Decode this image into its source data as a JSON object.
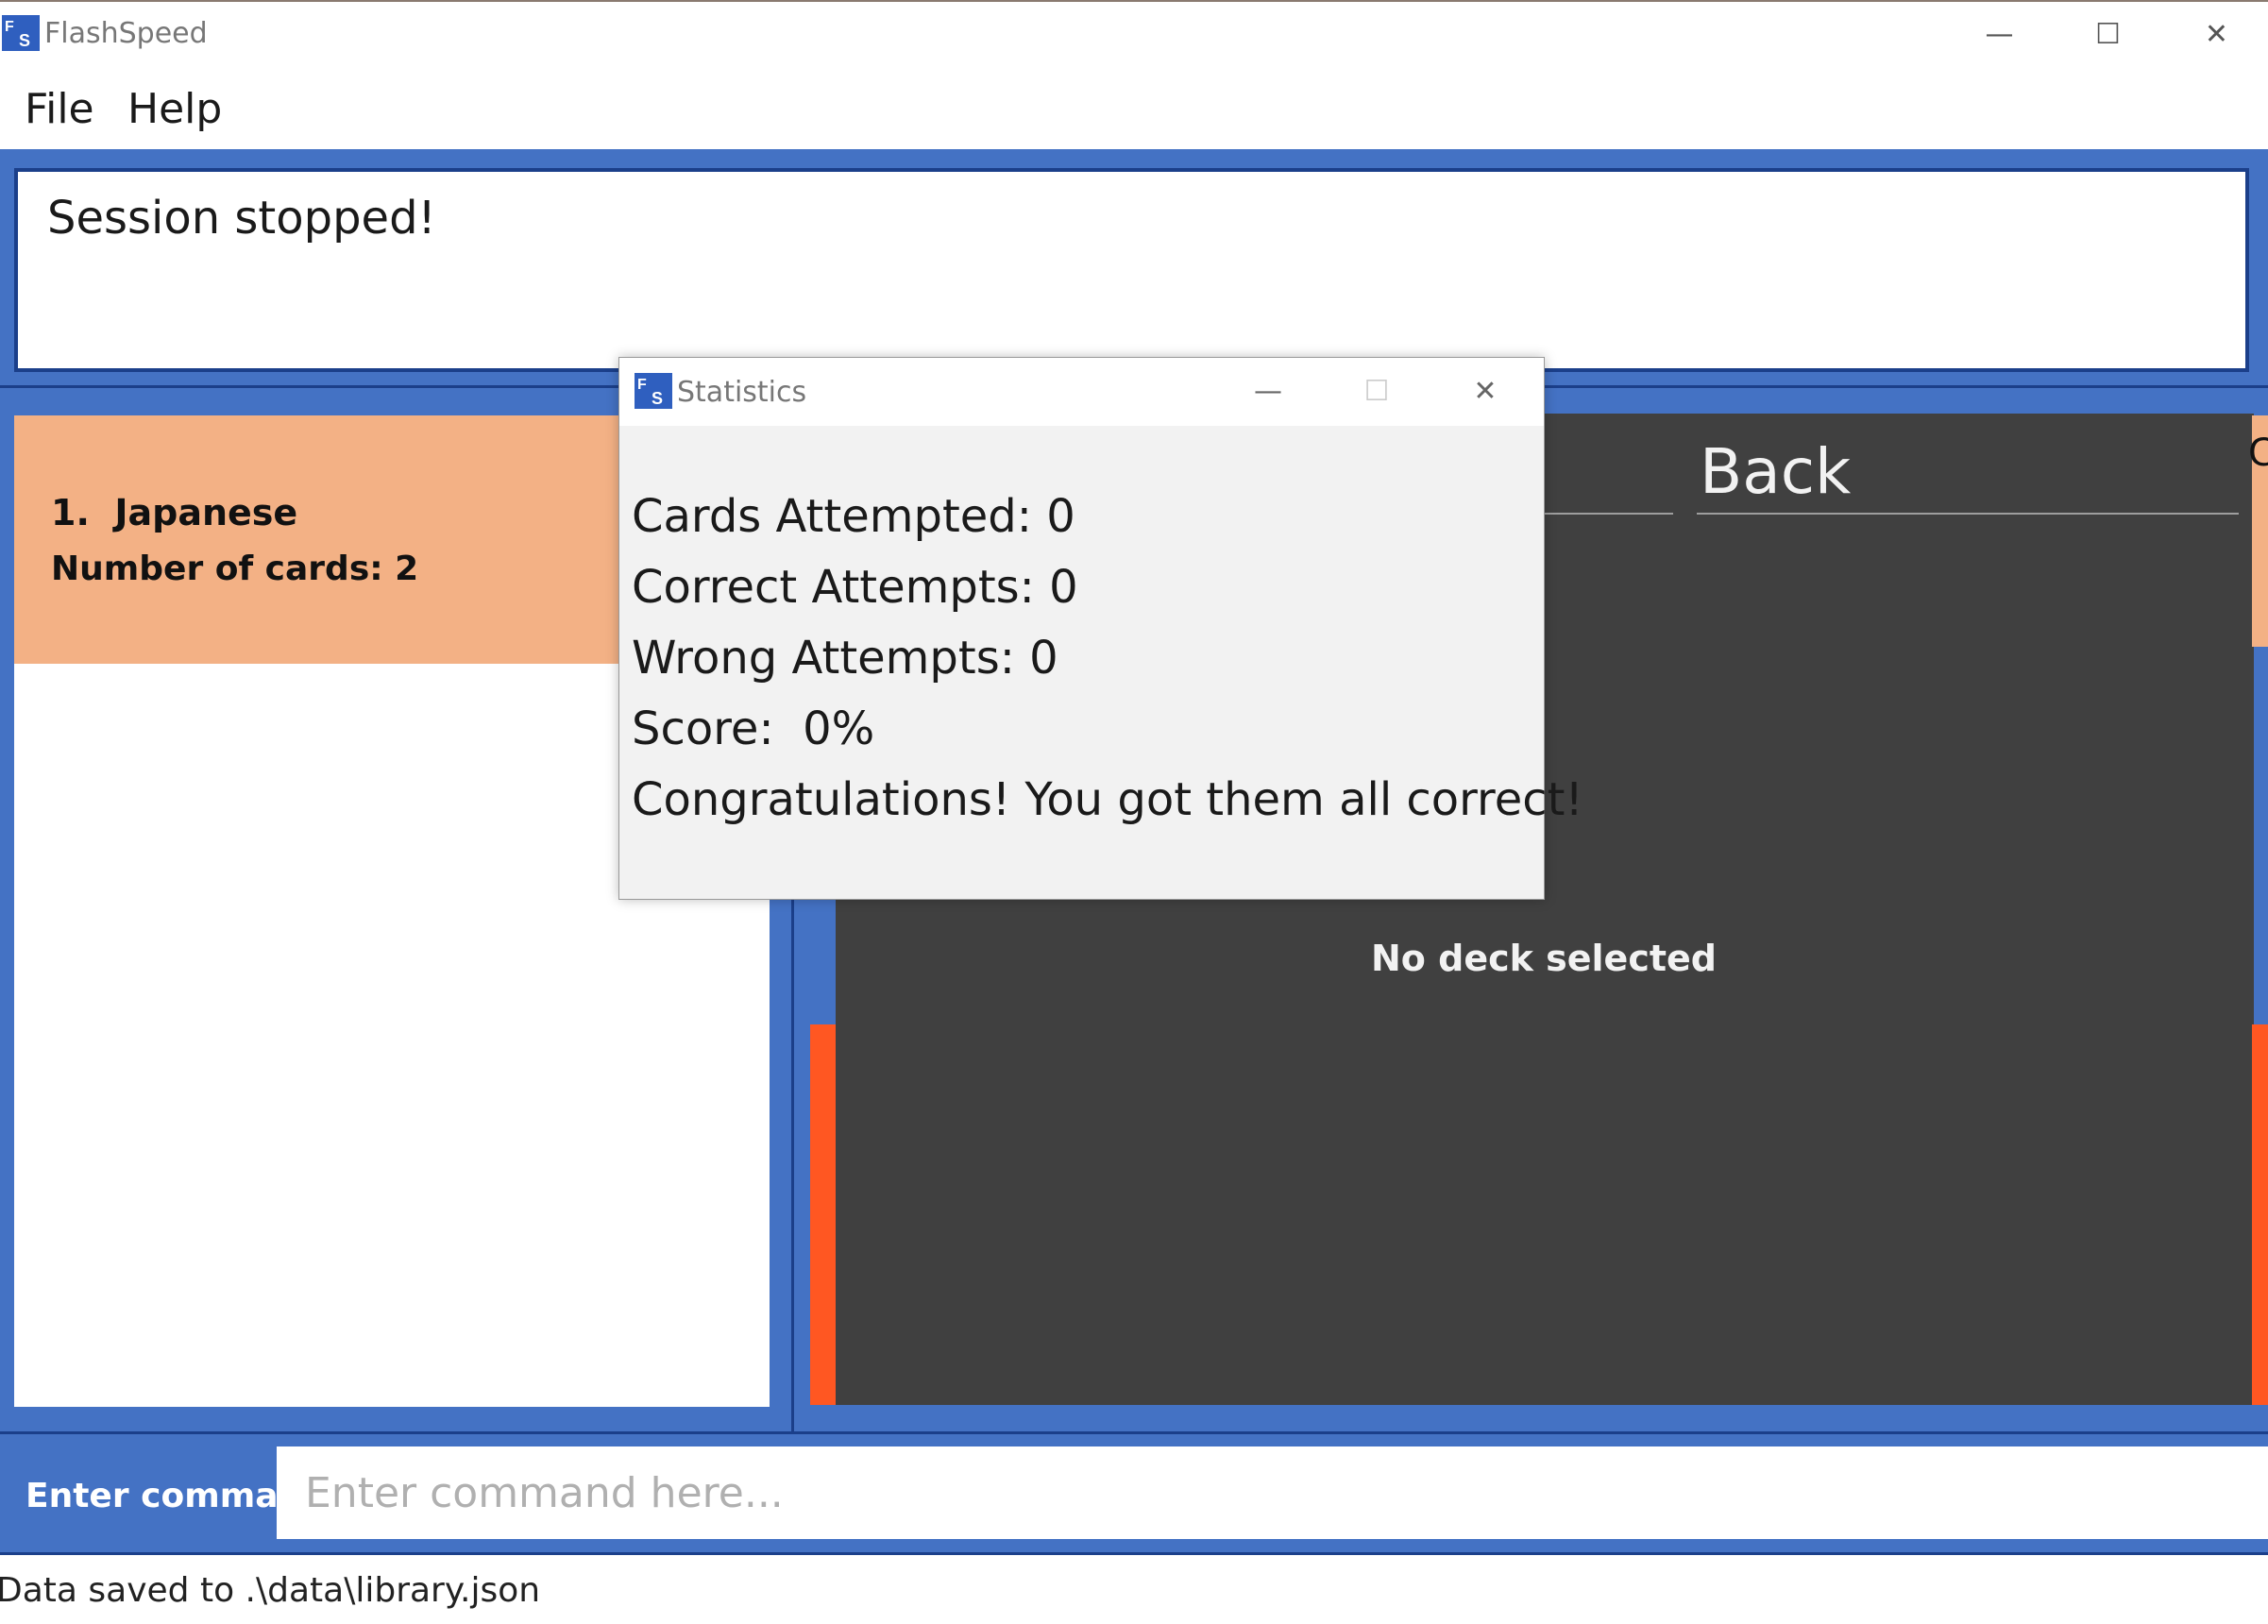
{
  "window": {
    "title": "FlashSpeed",
    "minimize_glyph": "—",
    "maximize_glyph": "☐",
    "close_glyph": "✕"
  },
  "menu": {
    "file": "File",
    "help": "Help"
  },
  "result_display": {
    "text": "Session stopped!"
  },
  "deck_list": {
    "items": [
      {
        "index": "1.",
        "name": "Japanese",
        "title": "1.  Japanese",
        "count_text": "Number of cards: 2"
      }
    ]
  },
  "card_panel": {
    "back_label": "Back",
    "side_partial_label": "Ca",
    "empty_message": "No deck selected"
  },
  "command_box": {
    "label": "Enter comma...",
    "placeholder": "Enter command here...",
    "value": ""
  },
  "status_bar": {
    "text": "Data saved to .\\data\\library.json"
  },
  "statistics_dialog": {
    "title": "Statistics",
    "minimize_glyph": "—",
    "maximize_glyph": "☐",
    "close_glyph": "✕",
    "lines": [
      "Cards Attempted: 0",
      "Correct Attempts: 0",
      "Wrong Attempts: 0",
      "Score:  0%",
      "Congratulations! You got them all correct!"
    ]
  },
  "colors": {
    "frame_blue": "#4472c4",
    "dark_blue_border": "#1b3f8a",
    "deck_card_peach": "#f3b185",
    "card_panel_dark": "#404040",
    "accent_orange": "#ff5722",
    "logo_blue": "#2f5fbf"
  },
  "icons": {
    "app_logo": "flashspeed-logo-icon",
    "dialog_logo": "flashspeed-logo-icon"
  }
}
